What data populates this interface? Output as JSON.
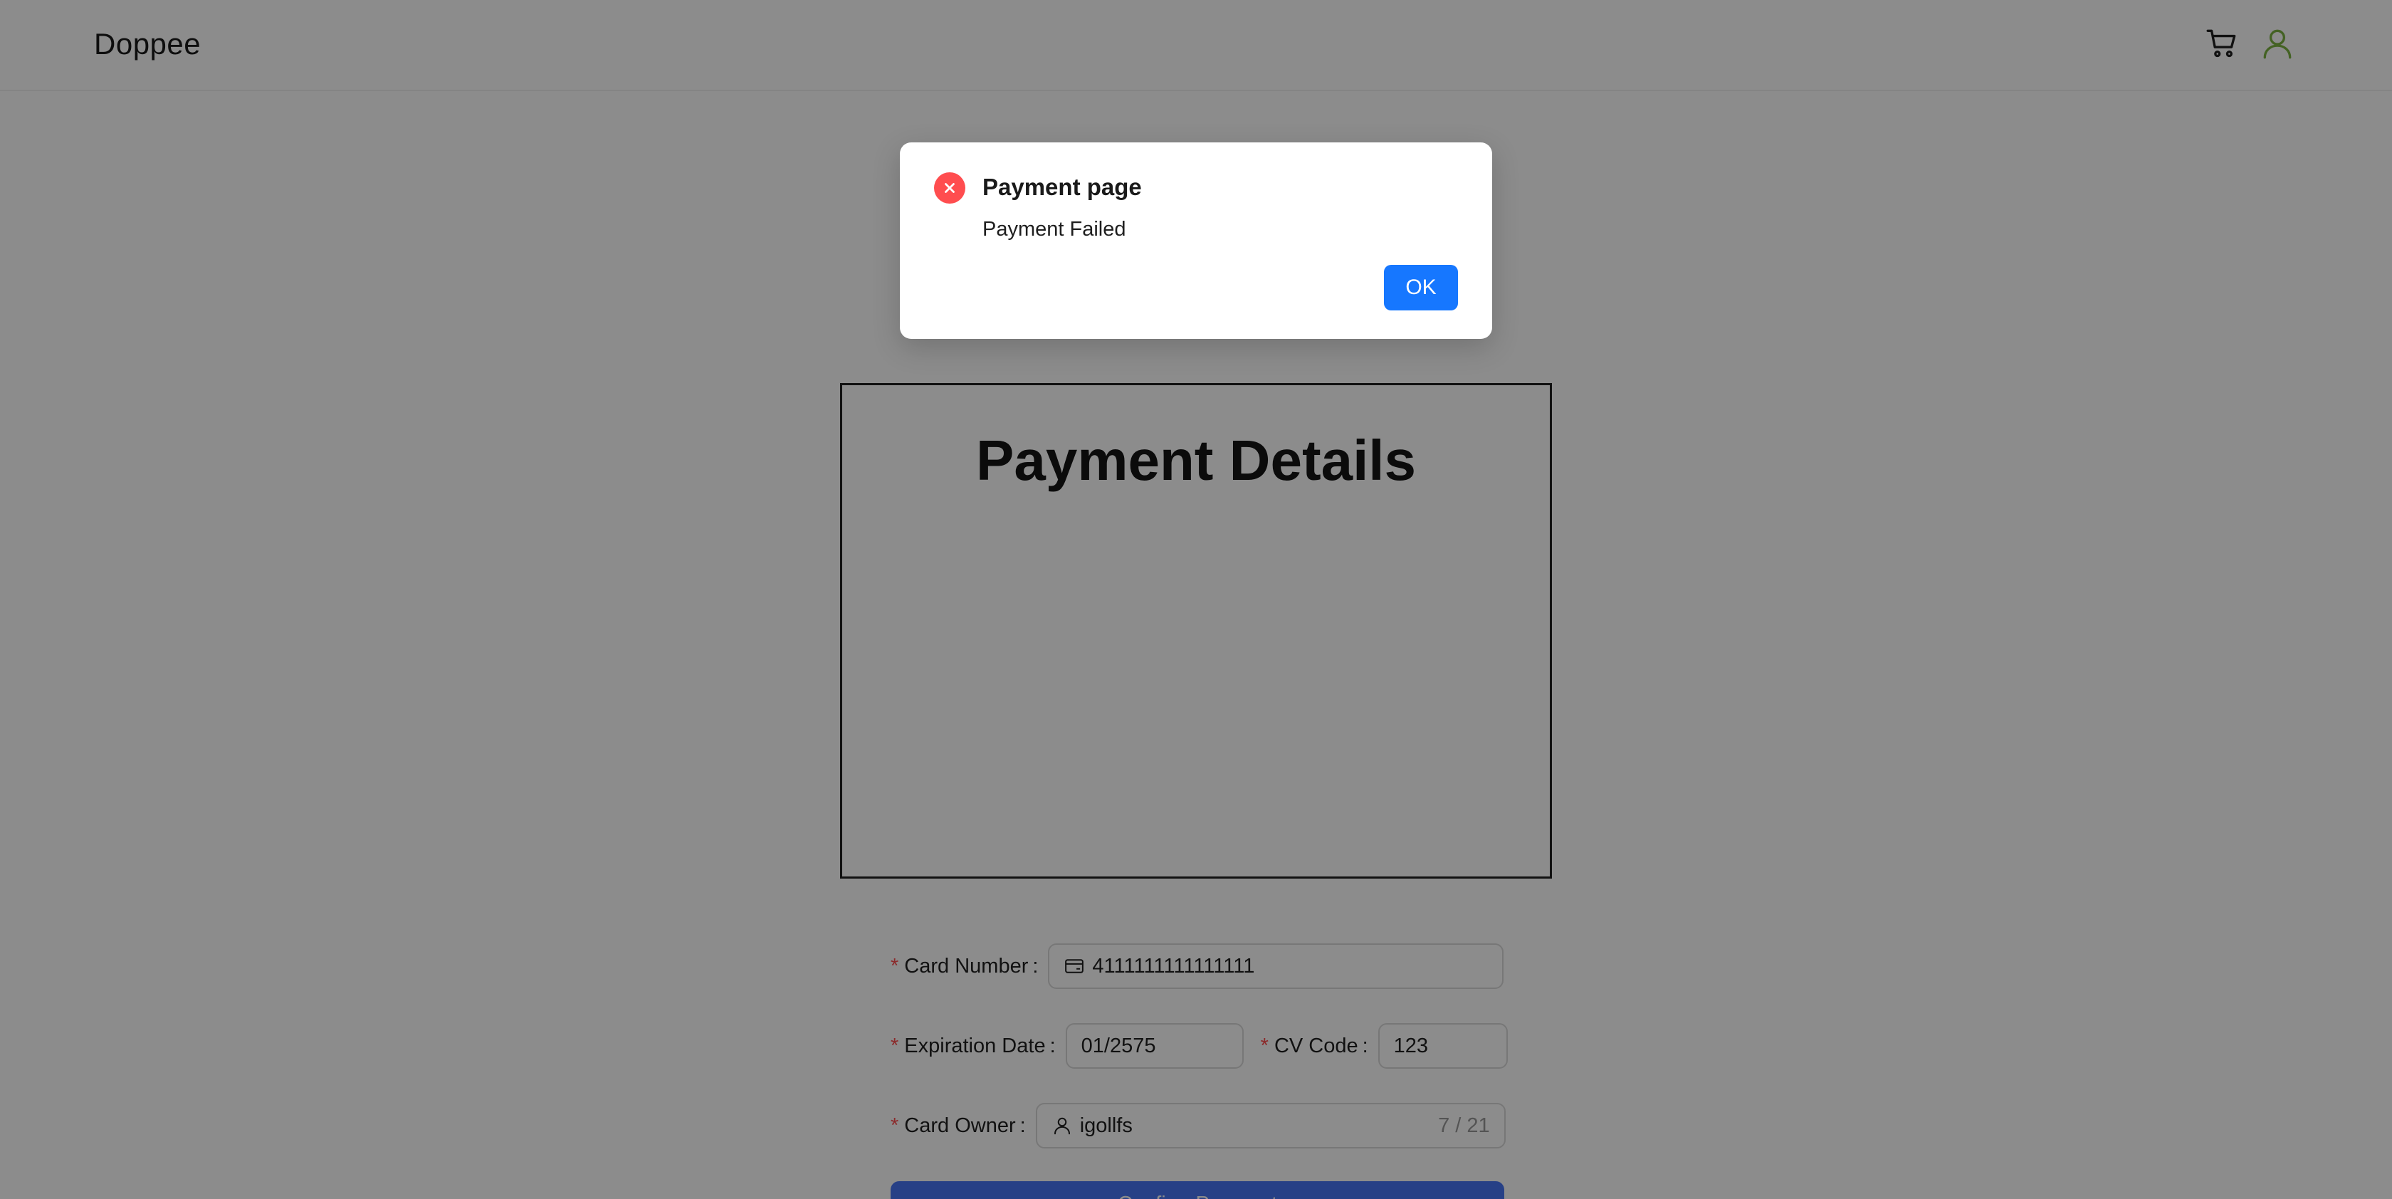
{
  "header": {
    "brand": "Doppee",
    "icons": {
      "cart": "cart-icon",
      "user": "user-icon"
    },
    "user_icon_color": "#7cb342"
  },
  "payment": {
    "title": "Payment Details",
    "card_number": {
      "label": "Card Number",
      "colon": ":",
      "required_mark": "*",
      "value": "4111111111111111",
      "prefix_icon": "credit-card-icon"
    },
    "expiration": {
      "label": "Expiration Date",
      "colon": ":",
      "required_mark": "*",
      "value": "01/2575"
    },
    "cv_code": {
      "label": "CV Code",
      "colon": ":",
      "required_mark": "*",
      "value": "123"
    },
    "owner": {
      "label": "Card Owner",
      "colon": ":",
      "required_mark": "*",
      "value": "igollfs",
      "prefix_icon": "user-icon",
      "count": "7 / 21"
    },
    "confirm_label": "Confirm Payment",
    "confirm_color": "#4776f5"
  },
  "modal": {
    "icon": "close-circle-icon",
    "icon_color": "#ff4d4f",
    "title": "Payment page",
    "content": "Payment Failed",
    "ok_label": "OK",
    "ok_color": "#1677ff"
  }
}
